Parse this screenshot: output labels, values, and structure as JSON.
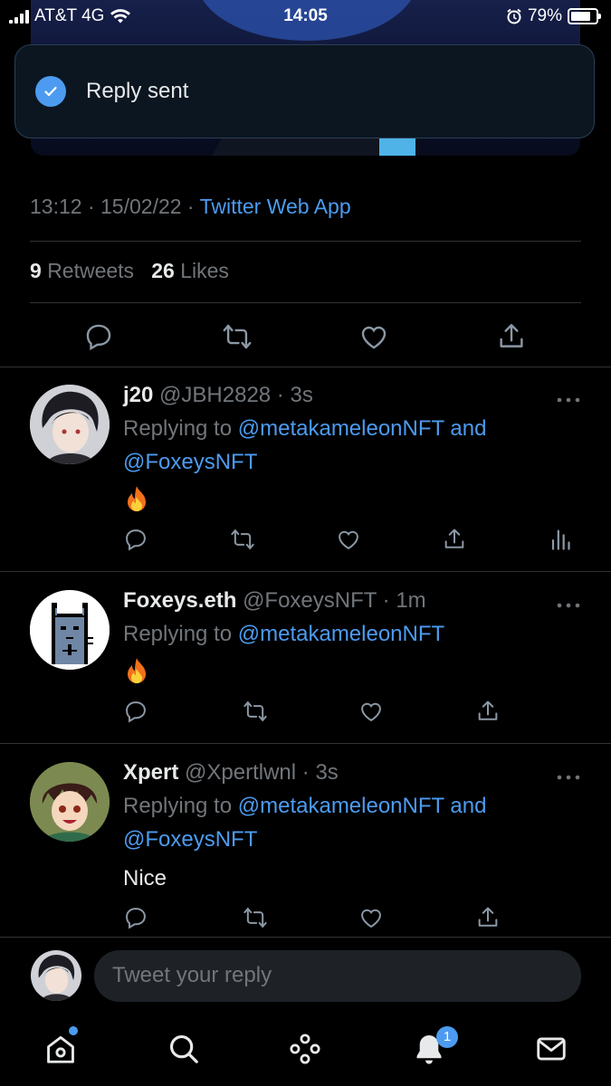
{
  "status_bar": {
    "carrier": "AT&T 4G",
    "time": "14:05",
    "battery_percent": "79%",
    "battery_level": 0.79,
    "icons": [
      "signal-icon",
      "wifi-icon",
      "alarm-icon",
      "battery-icon"
    ]
  },
  "toast": {
    "message": "Reply sent",
    "icon": "check-circle-icon"
  },
  "tweet": {
    "time": "13:12",
    "date": "15/02/22",
    "source": "Twitter Web App",
    "retweets": "9",
    "retweets_label": "Retweets",
    "likes": "26",
    "likes_label": "Likes",
    "actions": [
      "reply-icon",
      "retweet-icon",
      "like-icon",
      "share-icon"
    ]
  },
  "replies": [
    {
      "name": "j20",
      "handle": "@JBH2828",
      "age": "3s",
      "replying_to_label": "Replying to",
      "mention1": "@metakameleonNFT",
      "and_label": "and",
      "mention2": "@FoxeysNFT",
      "content": "flame-emoji"
    },
    {
      "name": "Foxeys.eth",
      "handle": "@FoxeysNFT",
      "age": "1m",
      "replying_to_label": "Replying to",
      "mention1": "@metakameleonNFT",
      "content": "flame-emoji"
    },
    {
      "name": "Xpert",
      "handle": "@Xpertlwnl",
      "age": "3s",
      "replying_to_label": "Replying to",
      "mention1": "@metakameleonNFT",
      "and_label": "and",
      "mention2": "@FoxeysNFT",
      "content": "Nice"
    }
  ],
  "composer": {
    "placeholder": "Tweet your reply"
  },
  "bottom_nav": {
    "items": [
      "home-icon",
      "search-icon",
      "spaces-icon",
      "notifications-icon",
      "messages-icon"
    ],
    "notifications_badge": "1"
  },
  "colors": {
    "accent": "#4c9bf0",
    "background": "#000000",
    "muted": "#71767b"
  }
}
